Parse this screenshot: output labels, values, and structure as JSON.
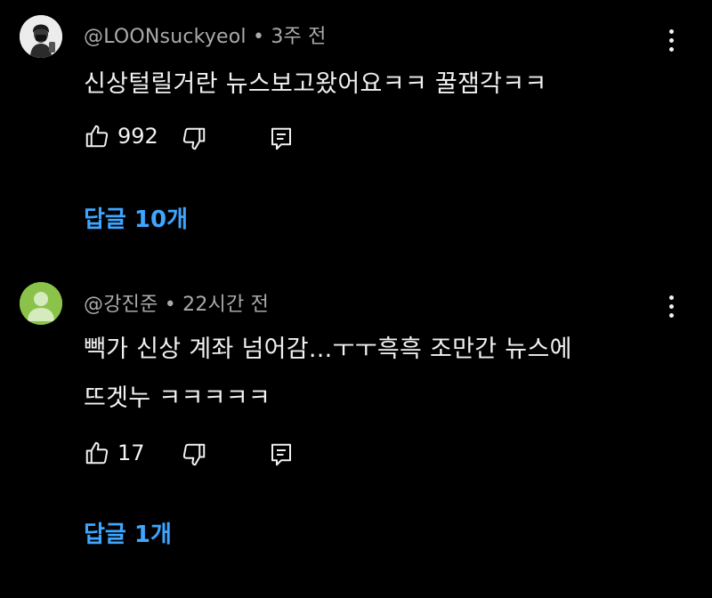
{
  "comments": [
    {
      "author": "@LOONsuckyeol",
      "separator": "•",
      "time": "3주 전",
      "lines": [
        "신상털릴거란 뉴스보고왔어요ㅋㅋ  꿀잼각ㅋㅋ"
      ],
      "likes": "992",
      "replies_label": "답글 10개",
      "avatar_icon": "person-with-mask-photo"
    },
    {
      "author": "@강진준",
      "separator": "•",
      "time": "22시간 전",
      "lines": [
        "빽가 신상 계좌 넘어감...ㅜㅜ흑흑 조만간 뉴스에",
        "뜨겟누 ㅋㅋㅋㅋㅋ"
      ],
      "likes": "17",
      "replies_label": "답글 1개",
      "avatar_icon": "default-user-avatar-green"
    }
  ],
  "colors": {
    "background": "#000000",
    "text": "#f1f1f1",
    "meta": "#aaaaaa",
    "link": "#3ea6ff",
    "default_avatar": "#8bc34a"
  }
}
